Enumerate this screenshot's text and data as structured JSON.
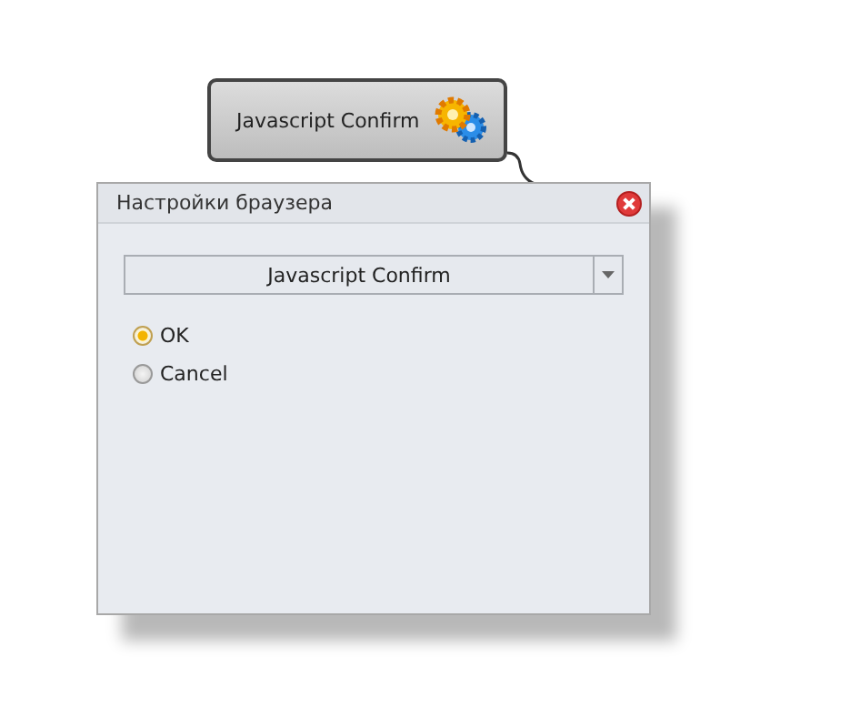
{
  "node": {
    "label": "Javascript Confirm"
  },
  "dialog": {
    "title": "Настройки браузера",
    "dropdown": {
      "value": "Javascript Confirm"
    },
    "options": [
      {
        "label": "OK",
        "selected": true
      },
      {
        "label": "Cancel",
        "selected": false
      }
    ]
  }
}
